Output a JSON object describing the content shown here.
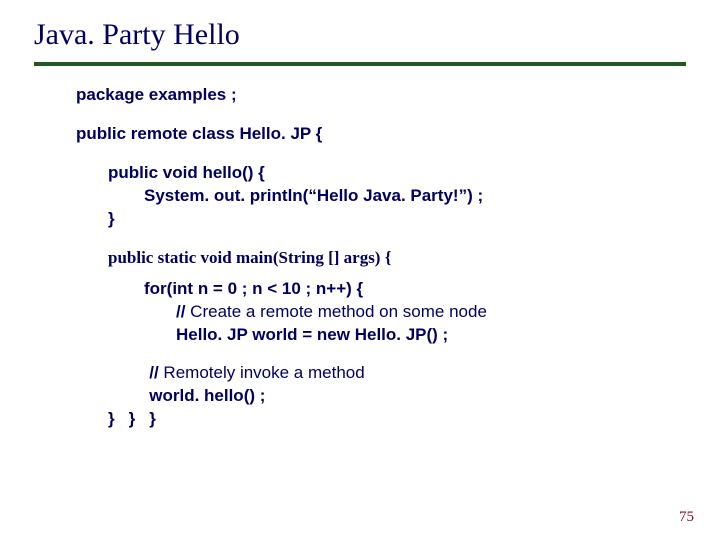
{
  "title": "Java. Party Hello",
  "code": {
    "pkg": "package examples ;",
    "classDecl": "public remote class Hello. JP {",
    "helloDecl": "public void hello() {",
    "println": "System. out. println(“Hello Java. Party!”) ;",
    "closeHello": "}",
    "mainDecl": "public static void main(String [] args) {",
    "forLine": "for(int n = 0 ; n < 10 ; n++) {",
    "comment1a": "// ",
    "comment1b": "Create a remote method on some node",
    "worldNew": "Hello. JP world = new Hello. JP() ;",
    "comment2a": "// ",
    "comment2b": "Remotely invoke a method",
    "worldCall": "world. hello() ;",
    "closeFor": "}",
    "closeMain": "}",
    "closeClass": "}"
  },
  "pageNumber": "75"
}
